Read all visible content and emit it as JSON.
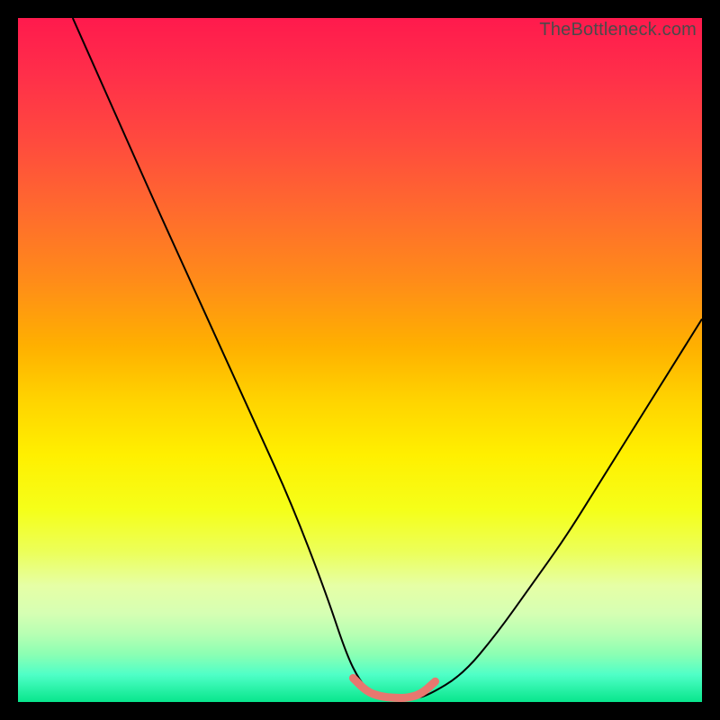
{
  "watermark": "TheBottleneck.com",
  "chart_data": {
    "type": "line",
    "title": "",
    "xlabel": "",
    "ylabel": "",
    "xlim": [
      0,
      100
    ],
    "ylim": [
      0,
      100
    ],
    "grid": false,
    "legend": false,
    "series": [
      {
        "name": "bottleneck-curve",
        "color": "#000000",
        "stroke_width": 2,
        "x": [
          8,
          12,
          16,
          20,
          25,
          30,
          35,
          40,
          45,
          48,
          50,
          52,
          55,
          58,
          60,
          65,
          70,
          75,
          80,
          85,
          90,
          95,
          100
        ],
        "y": [
          100,
          91,
          82,
          73,
          62,
          51,
          40,
          29,
          16,
          7,
          3,
          1,
          0.5,
          0.5,
          1,
          4,
          10,
          17,
          24,
          32,
          40,
          48,
          56
        ]
      },
      {
        "name": "optimal-range-marker",
        "color": "#e8776f",
        "stroke_width": 9,
        "linecap": "round",
        "x": [
          49,
          51,
          53,
          55,
          57,
          59,
          61
        ],
        "y": [
          3.5,
          1.5,
          0.8,
          0.6,
          0.6,
          1.2,
          3.0
        ]
      }
    ]
  }
}
